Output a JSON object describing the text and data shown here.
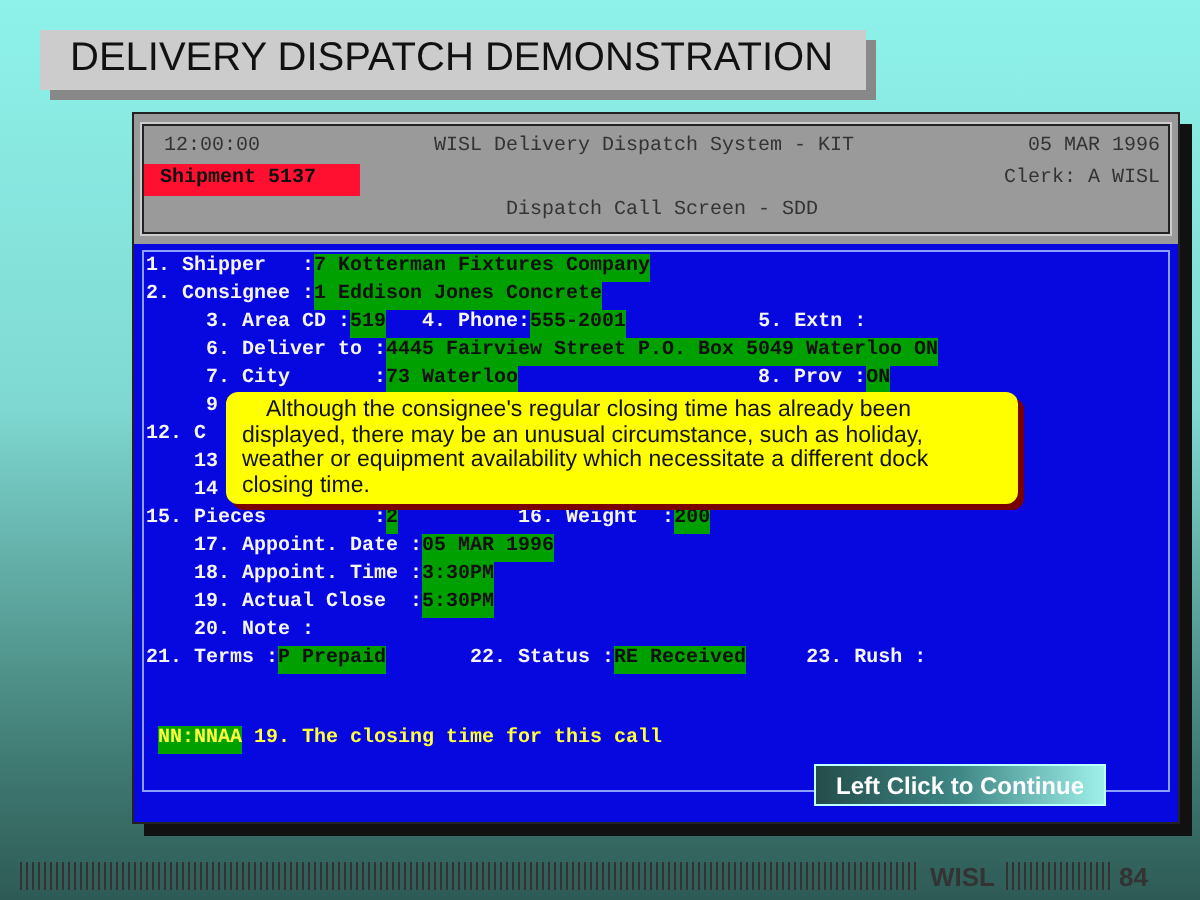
{
  "slide_title": "DELIVERY DISPATCH DEMONSTRATION",
  "terminal": {
    "time": "12:00:00",
    "system_title": "WISL Delivery Dispatch System - KIT",
    "date": "05 MAR 1996",
    "shipment": "Shipment 5137",
    "clerk": "Clerk: A WISL",
    "screen_title": "Dispatch Call Screen - SDD"
  },
  "form_rows": [
    [
      {
        "label": "1. Shipper   :",
        "value": "7 Kotterman Fixtures Company"
      }
    ],
    [
      {
        "label": "2. Consignee :",
        "value": "1 Eddison Jones Concrete"
      }
    ],
    [
      {
        "label": "3. Area CD :",
        "value": "519"
      },
      {
        "label": "4. Phone:",
        "value": "555-2001"
      },
      {
        "label": "5. Extn :"
      }
    ],
    [
      {
        "label": "6. Deliver to :",
        "value": "4445 Fairview Street P.O. Box 5049 Waterloo ON"
      }
    ],
    [
      {
        "label": "7. City       :",
        "value": "73 Waterloo"
      },
      {
        "label": "8. Prov :",
        "value": "ON"
      }
    ],
    [
      {
        "label": "9"
      }
    ],
    [
      {
        "label": "12. C"
      }
    ],
    [
      {
        "label": "13"
      }
    ],
    [
      {
        "label": "14"
      }
    ],
    [
      {
        "label": "15. Pieces         :",
        "value": "2"
      },
      {
        "label": "16. Weight  :",
        "value": "200"
      }
    ],
    [
      {
        "label": "17. Appoint. Date :",
        "value": "05 MAR 1996"
      }
    ],
    [
      {
        "label": "18. Appoint. Time :",
        "value": "3:30PM"
      }
    ],
    [
      {
        "label": "19. Actual Close  :",
        "value": "5:30PM"
      }
    ],
    [
      {
        "label": "20. Note :"
      }
    ],
    [
      {
        "label": "21. Terms :",
        "value": "P Prepaid"
      },
      {
        "label": "22. Status :",
        "value": "RE Received"
      },
      {
        "label": "23. Rush :"
      }
    ]
  ],
  "hint": {
    "format": "NN:NNAA",
    "message": "19. The closing time for this call"
  },
  "callout": "Although the consignee's regular closing time has already been displayed, there may be an unusual circumstance, such as holiday, weather or equipment availability which necessitate a different dock closing time.",
  "continue_button": "Left Click to Continue",
  "footer": {
    "brand": "WISL",
    "page": "84"
  }
}
